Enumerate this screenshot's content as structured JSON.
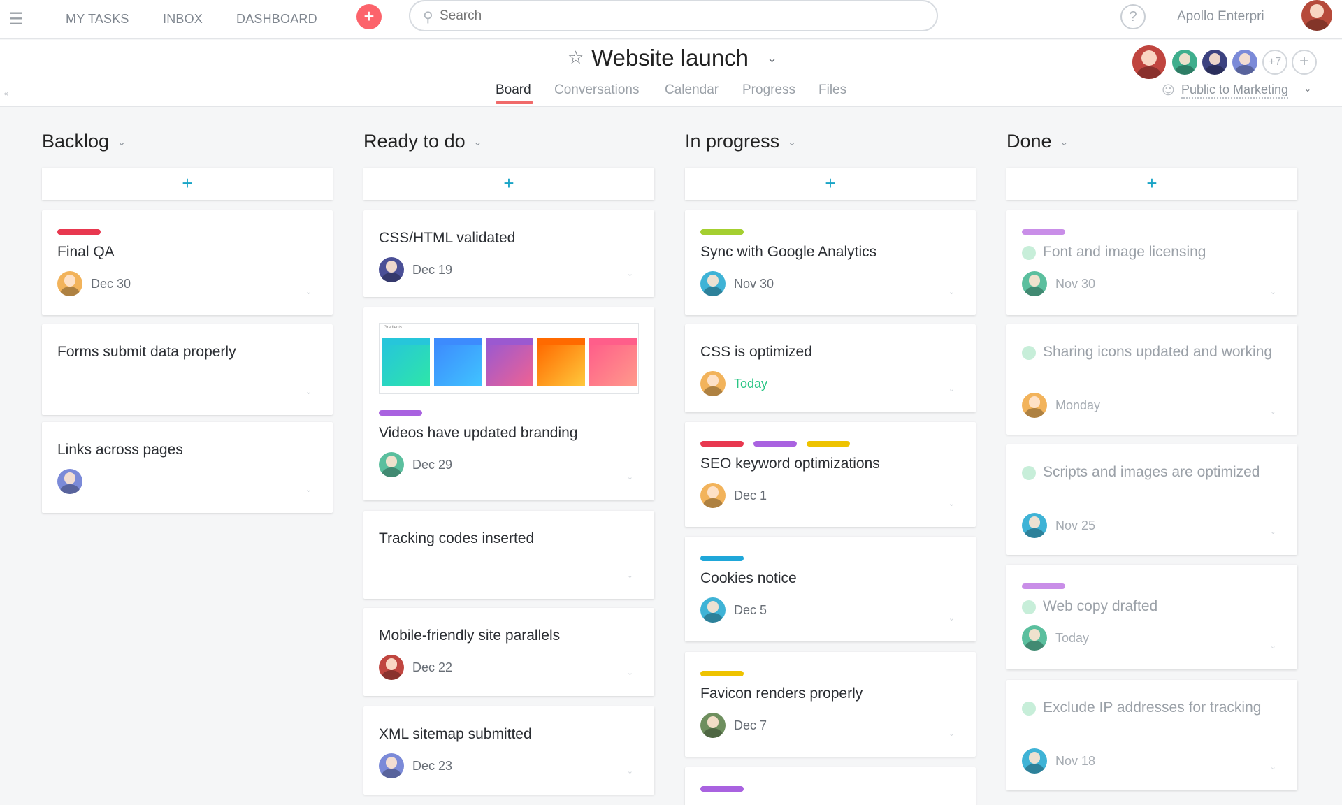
{
  "topbar": {
    "nav": [
      "MY TASKS",
      "INBOX",
      "DASHBOARD"
    ],
    "add_label": "+",
    "search_placeholder": "Search",
    "help_label": "?",
    "org_name": "Apollo Enterpris..."
  },
  "project": {
    "title": "Website launch",
    "tabs": [
      "Board",
      "Conversations",
      "Calendar",
      "Progress",
      "Files"
    ],
    "active_tab": "Board",
    "members_more": "+7",
    "add_member_label": "+",
    "privacy": "Public to Marketing"
  },
  "colors": {
    "red": "#e8384f",
    "green": "#a4cf30",
    "purple": "#a962e0",
    "lavender": "#c98ee8",
    "yellow": "#eec300",
    "blue": "#1fa7d9",
    "accent_orange": "#fc636b",
    "add_blue": "#19a4c6",
    "today_green": "#29c584"
  },
  "columns": [
    {
      "title": "Backlog",
      "add_label": "+",
      "cards": [
        {
          "title": "Final QA",
          "tags": [
            "red"
          ],
          "date": "Dec 30",
          "avatar_color": "#f2b35b"
        },
        {
          "title": "Forms submit data properly",
          "tags": [],
          "date": "",
          "avatar_color": ""
        },
        {
          "title": "Links across pages",
          "tags": [],
          "date": "",
          "avatar_color": "#7b8ad8"
        }
      ]
    },
    {
      "title": "Ready to do",
      "add_label": "+",
      "cards": [
        {
          "title": "CSS/HTML validated",
          "tags": [],
          "date": "Dec 19",
          "avatar_color": "#4a4f96"
        },
        {
          "title": "Videos have updated branding",
          "tags": [
            "purple"
          ],
          "date": "Dec 29",
          "avatar_color": "#5bbf9e",
          "thumbnail": true,
          "thumbnail_label": "Gradients"
        },
        {
          "title": "Tracking codes inserted",
          "tags": [],
          "date": "",
          "avatar_color": ""
        },
        {
          "title": "Mobile-friendly site parallels",
          "tags": [],
          "date": "Dec 22",
          "avatar_color": "#c0453f"
        },
        {
          "title": "XML sitemap submitted",
          "tags": [],
          "date": "Dec 23",
          "avatar_color": "#7b8ad8"
        }
      ]
    },
    {
      "title": "In progress",
      "add_label": "+",
      "cards": [
        {
          "title": "Sync with Google Analytics",
          "tags": [
            "green"
          ],
          "date": "Nov 30",
          "avatar_color": "#3fb3d6"
        },
        {
          "title": "CSS is optimized",
          "tags": [],
          "date": "Today",
          "today": true,
          "avatar_color": "#f2b35b"
        },
        {
          "title": "SEO keyword optimizations",
          "tags": [
            "red",
            "purple",
            "yellow"
          ],
          "date": "Dec 1",
          "avatar_color": "#f2b35b"
        },
        {
          "title": "Cookies notice",
          "tags": [
            "blue"
          ],
          "date": "Dec 5",
          "avatar_color": "#3fb3d6"
        },
        {
          "title": "Favicon renders properly",
          "tags": [
            "yellow"
          ],
          "date": "Dec 7",
          "avatar_color": "#6e8f5e"
        },
        {
          "title": "",
          "tags": [
            "purple"
          ],
          "date": "",
          "avatar_color": ""
        }
      ]
    },
    {
      "title": "Done",
      "add_label": "+",
      "cards": [
        {
          "title": "Font and image licensing",
          "tags": [
            "lavender"
          ],
          "date": "Nov 30",
          "avatar_color": "#5bbf9e"
        },
        {
          "title": "Sharing icons updated and working",
          "tags": [],
          "date": "Monday",
          "avatar_color": "#f2b35b"
        },
        {
          "title": "Scripts and images are optimized",
          "tags": [],
          "date": "Nov 25",
          "avatar_color": "#3fb3d6"
        },
        {
          "title": "Web copy drafted",
          "tags": [
            "lavender"
          ],
          "date": "Today",
          "today": true,
          "avatar_color": "#5bbf9e"
        },
        {
          "title": "Exclude IP addresses for tracking",
          "tags": [],
          "date": "Nov 18",
          "avatar_color": "#3fb3d6"
        }
      ]
    }
  ]
}
